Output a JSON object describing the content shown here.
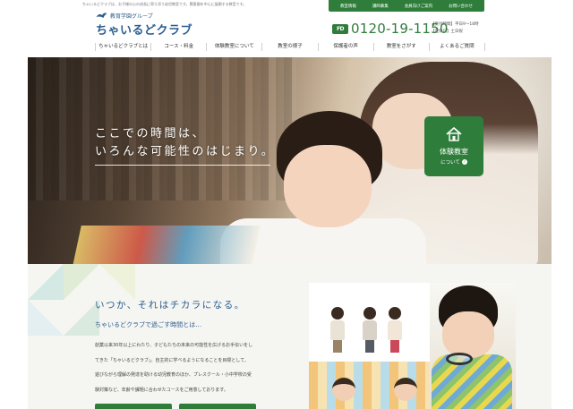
{
  "header": {
    "tagline": "ちゃいるどクラブは、お子様の心の成長に寄り添う幼児教室です。関東圏を中心に展開する教室です。",
    "utility_links": [
      "教室情報",
      "講師募集",
      "会員向けご案内",
      "お問い合わせ"
    ],
    "brand_group": "教育学園グループ",
    "brand_name": "ちゃいるどクラブ",
    "phone_badge": "FD",
    "phone": "0120-19-1150",
    "hours_line1": "【受付時間】平日9～18時",
    "hours_line2": "【定休日】土日祝"
  },
  "nav": {
    "items": [
      "ちゃいるどクラブとは",
      "コース・料金",
      "体験教室について",
      "教室の様子",
      "保護者の声",
      "教室をさがす",
      "よくあるご質問"
    ]
  },
  "hero": {
    "catch_line1": "ここでの時間は、",
    "catch_line2": "いろんな可能性のはじまり。",
    "trial_button_label": "体験教室",
    "trial_button_sub": "について"
  },
  "intro": {
    "title": "いつか、それはチカラになる。",
    "subtitle": "ちゃいるどクラブで過ごす時間とは…",
    "body_lines": [
      "創業以来30年以上にわたり、子どもたちの未来の可能性を広げるお手伝いをし",
      "てきた「ちゃいるどクラブ」。自主的に学べるようになることを目標として、",
      "遊びながら理解の発達を助ける幼児教育のほか、プレスクール・小中学校の受",
      "験対策など、年齢や課題に合わせたコースをご用意しております。"
    ]
  },
  "colors": {
    "brand_green": "#2f7d3b",
    "brand_blue": "#2a5d8f"
  }
}
